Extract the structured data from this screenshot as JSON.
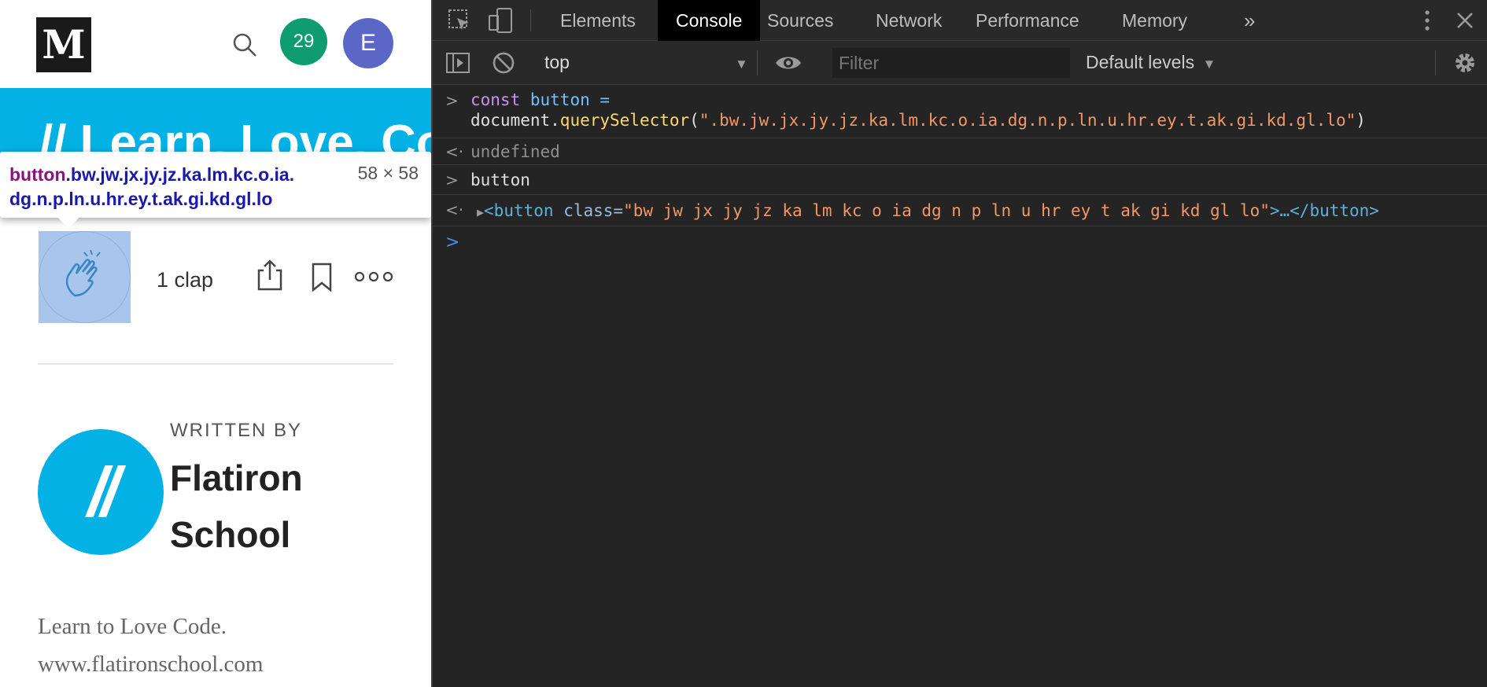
{
  "medium": {
    "logo": "M",
    "notification_count": "29",
    "avatar_initial": "E",
    "banner_text": "// Learn. Love. Code.",
    "tooltip": {
      "tag": "button",
      "selector_rest": ".bw.jw.jx.jy.jz.ka.lm.kc.o.ia.",
      "selector_line2": "dg.n.p.ln.u.hr.ey.t.ak.gi.kd.gl.lo",
      "size": "58 × 58"
    },
    "clap_count": "1 clap",
    "written_by": "WRITTEN BY",
    "author_logo": "//",
    "author_name_line1": "Flatiron",
    "author_name_line2": "School",
    "bio_line1": "Learn to Love Code.",
    "bio_line2": "www.flatironschool.com"
  },
  "devtools": {
    "tabs": [
      "Elements",
      "Console",
      "Sources",
      "Network",
      "Performance",
      "Memory"
    ],
    "active_tab": "Console",
    "overflow": "»",
    "context": "top",
    "filter_placeholder": "Filter",
    "levels": "Default levels",
    "console": {
      "line1_kw": "const",
      "line1_var": "button",
      "line1_eq": " =",
      "line2_obj": "document.",
      "line2_fn": "querySelector",
      "line2_str": "\".bw.jw.jx.jy.jz.ka.lm.kc.o.ia.dg.n.p.ln.u.hr.ey.t.ak.gi.kd.gl.lo\"",
      "result1": "undefined",
      "input2": "button",
      "result2_open": "<button",
      "result2_attr": " class=",
      "result2_val": "\"bw jw jx jy jz ka lm kc o ia dg n p ln u hr ey t ak gi kd gl lo\"",
      "result2_close": ">…</button>"
    }
  }
}
